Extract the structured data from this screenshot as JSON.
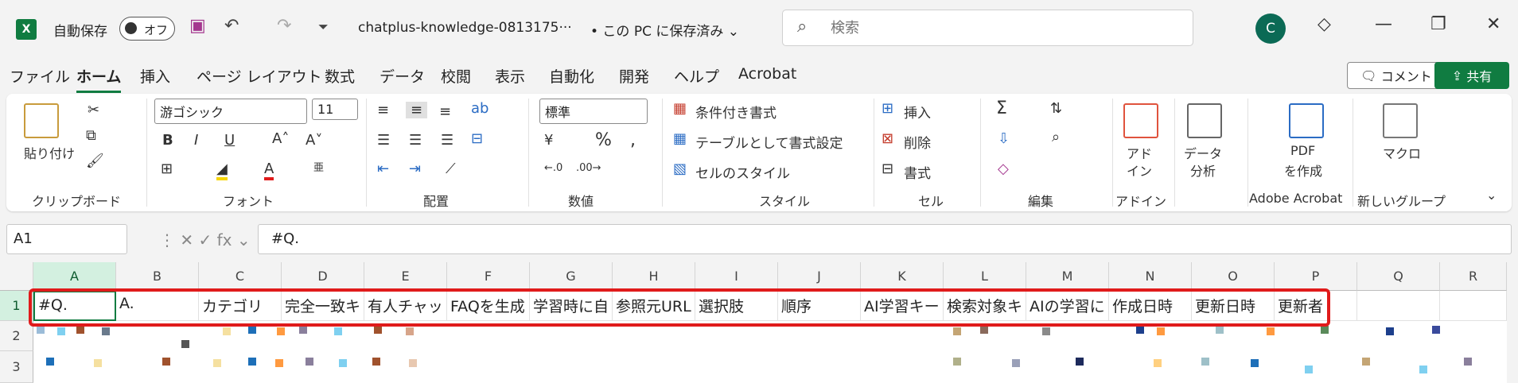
{
  "title": {
    "autosave_label": "自動保存",
    "toggle_label": "オフ",
    "filename": "chatplus-knowledge-0813175···",
    "save_state": "• この PC に保存済み ⌄",
    "search_placeholder": "検索",
    "avatar_initial": "C"
  },
  "menu": {
    "tabs": [
      "ファイル",
      "ホーム",
      "挿入",
      "ページ レイアウト",
      "数式",
      "データ",
      "校閲",
      "表示",
      "自動化",
      "開発",
      "ヘルプ",
      "Acrobat"
    ],
    "comment_label": "コメント",
    "share_label": "共有"
  },
  "ribbon": {
    "clipboard": {
      "paste": "貼り付け",
      "label": "クリップボード"
    },
    "font": {
      "family": "游ゴシック",
      "size": "11",
      "label": "フォント"
    },
    "alignment": {
      "label": "配置"
    },
    "number": {
      "format": "標準",
      "label": "数値"
    },
    "styles": {
      "conditional": "条件付き書式",
      "table": "テーブルとして書式設定",
      "cell_styles": "セルのスタイル",
      "label": "スタイル"
    },
    "cells": {
      "insert": "挿入",
      "delete": "削除",
      "format": "書式",
      "label": "セル"
    },
    "editing": {
      "label": "編集"
    },
    "addins": {
      "name": "アド\nイン",
      "line1": "アド",
      "line2": "イン",
      "label": "アドイン"
    },
    "analysis": {
      "line1": "データ",
      "line2": "分析"
    },
    "pdf": {
      "line1": "PDF",
      "line2": "を作成",
      "label": "Adobe Acrobat"
    },
    "macro": {
      "name": "マクロ",
      "label": "新しいグループ"
    }
  },
  "formula_bar": {
    "name_box": "A1",
    "formula": "#Q."
  },
  "sheet": {
    "columns": [
      "A",
      "B",
      "C",
      "D",
      "E",
      "F",
      "G",
      "H",
      "I",
      "J",
      "K",
      "L",
      "M",
      "N",
      "O",
      "P",
      "Q",
      "R"
    ],
    "rows": [
      "1",
      "2",
      "3"
    ],
    "row1": [
      "#Q.",
      "A.",
      "カテゴリ",
      "完全一致キ",
      "有人チャッ",
      "FAQを生成",
      "学習時に自",
      "参照元URL",
      "選択肢",
      "順序",
      "AI学習キー",
      "検索対象キ",
      "AIの学習に",
      "作成日時",
      "更新日時",
      "更新者",
      "",
      ""
    ]
  },
  "colors": {
    "accent": "#107c41",
    "highlight": "#e01b1b"
  }
}
